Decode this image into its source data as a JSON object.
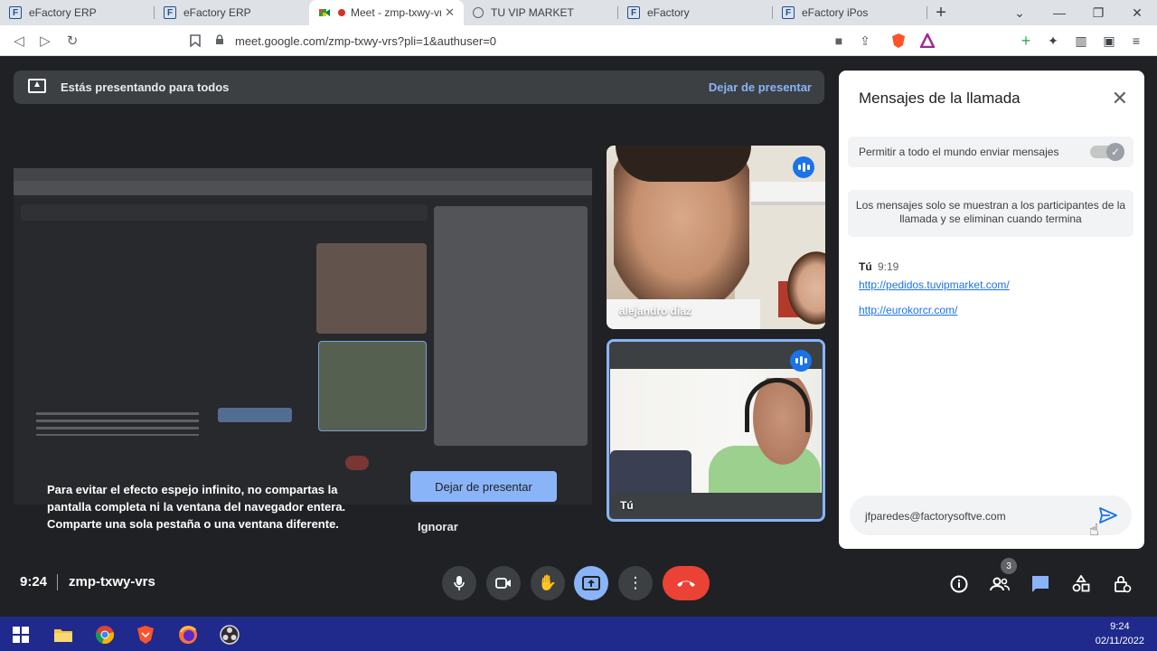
{
  "browser": {
    "tabs": [
      {
        "title": "eFactory ERP",
        "icon": "efactory-favicon",
        "active": false
      },
      {
        "title": "eFactory ERP",
        "icon": "efactory-favicon",
        "active": false
      },
      {
        "title": "Meet - zmp-txwy-vr",
        "icon": "google-meet-favicon",
        "active": true
      },
      {
        "title": "TU VIP MARKET",
        "icon": "globe-favicon",
        "active": false
      },
      {
        "title": "eFactory",
        "icon": "efactory-favicon",
        "active": false
      },
      {
        "title": "eFactory iPos",
        "icon": "efactory-favicon",
        "active": false
      }
    ],
    "url": "meet.google.com/zmp-txwy-vrs?pli=1&authuser=0"
  },
  "meet": {
    "banner_text": "Estás presentando para todos",
    "stop_presenting_label": "Dejar de presentar",
    "mirror_warning": {
      "text": "Para evitar el efecto espejo infinito, no compartas la pantalla completa ni la ventana del navegador entera. Comparte una sola pestaña o una ventana diferente.",
      "stop_button": "Dejar de presentar",
      "ignore_button": "Ignorar"
    },
    "participants": [
      {
        "name": "alejandro diaz",
        "speaking_indicator": true
      },
      {
        "name": "Tú",
        "speaking_indicator": true
      }
    ],
    "time": "9:24",
    "meeting_code": "zmp-txwy-vrs",
    "people_count": "3"
  },
  "chat": {
    "title": "Mensajes de la llamada",
    "allow_everyone_label": "Permitir a todo el mundo enviar mensajes",
    "allow_everyone_enabled": true,
    "info_note": "Los mensajes solo se muestran a los participantes de la llamada y se eliminan cuando termina",
    "messages": [
      {
        "sender": "Tú",
        "time": "9:19",
        "links": [
          "http://pedidos.tuvipmarket.com/",
          "http://eurokorcr.com/"
        ]
      }
    ],
    "input_value": "jfparedes@factorysoftve.com"
  },
  "taskbar": {
    "time": "9:24",
    "date": "02/11/2022"
  },
  "colors": {
    "meet_bg": "#202124",
    "accent_blue": "#8ab4f8",
    "end_call_red": "#ea4335",
    "taskbar": "#1f2a8c"
  }
}
